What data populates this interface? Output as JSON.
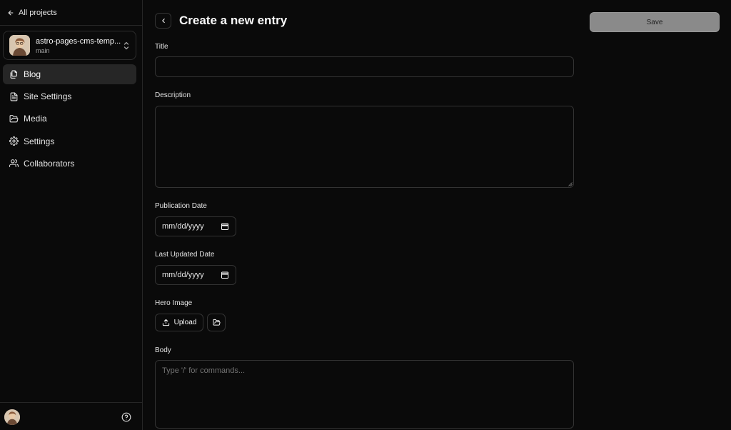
{
  "sidebar": {
    "back_label": "All projects",
    "repo": {
      "name": "astro-pages-cms-temp...",
      "branch": "main"
    },
    "nav": [
      {
        "label": "Blog",
        "icon": "files-icon",
        "active": true
      },
      {
        "label": "Site Settings",
        "icon": "file-text-icon",
        "active": false
      },
      {
        "label": "Media",
        "icon": "folder-open-icon",
        "active": false
      },
      {
        "label": "Settings",
        "icon": "gear-icon",
        "active": false
      },
      {
        "label": "Collaborators",
        "icon": "users-icon",
        "active": false
      }
    ]
  },
  "header": {
    "title": "Create a new entry",
    "save_label": "Save"
  },
  "form": {
    "title_label": "Title",
    "title_value": "",
    "description_label": "Description",
    "description_value": "",
    "publication_date_label": "Publication Date",
    "publication_date_value": "mm/dd/yyyy",
    "last_updated_label": "Last Updated Date",
    "last_updated_value": "mm/dd/yyyy",
    "hero_image_label": "Hero Image",
    "upload_label": "Upload",
    "body_label": "Body",
    "body_placeholder": "Type '/' for commands..."
  },
  "colors": {
    "background": "#0a0a0a",
    "border": "#333333",
    "save_button": "#8a8a8a",
    "active_nav": "#262626"
  }
}
